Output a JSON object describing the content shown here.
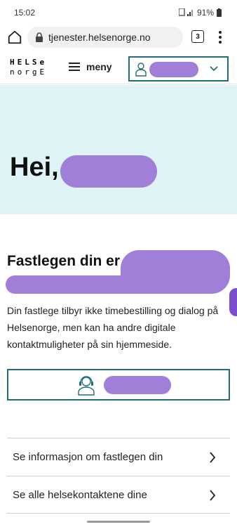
{
  "status": {
    "time": "15:02",
    "battery": "91%"
  },
  "browser": {
    "url": "tjenester.helsenorge.no",
    "tab_count": "3"
  },
  "header": {
    "logo_line1": "HELSe",
    "logo_line2": "norgE",
    "menu_label": "meny"
  },
  "hero": {
    "greeting": "Hei,"
  },
  "gp": {
    "title": "Fastlegen din er",
    "description": "Din fastlege tilbyr ikke timebestilling og dialog på Helsenorge, men kan ha andre digitale kontaktmuligheter på sin hjemmeside."
  },
  "links": [
    {
      "label": "Se informasjon om fastlegen din"
    },
    {
      "label": "Se alle helsekontaktene dine"
    }
  ],
  "colors": {
    "accent": "#1f6f78",
    "hero_bg": "#def4f6",
    "redaction": "#a07fd9"
  },
  "icons": [
    "home-icon",
    "lock-icon",
    "tabs-icon",
    "more-vert-icon",
    "hamburger-icon",
    "person-icon",
    "chevron-down-icon",
    "headset-icon",
    "chevron-right-icon"
  ]
}
